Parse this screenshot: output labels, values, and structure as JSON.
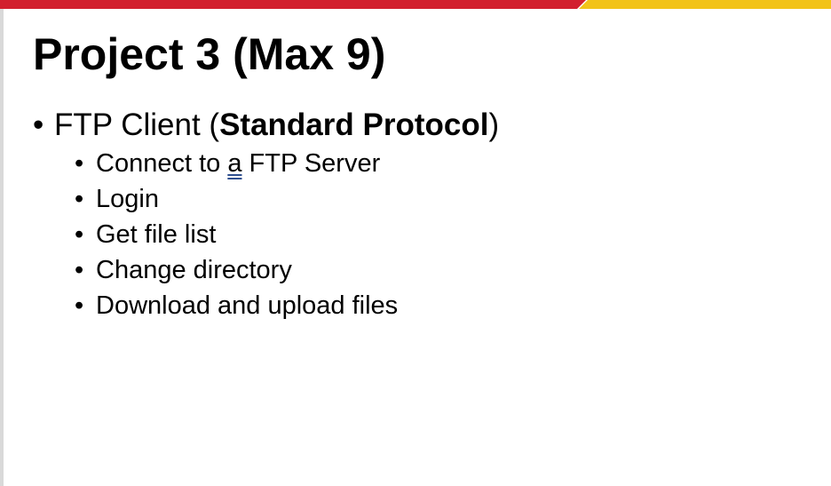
{
  "slide": {
    "title": "Project 3 (Max 9)",
    "accent_colors": {
      "red": "#d21f2e",
      "yellow": "#f2c318",
      "divider": "#ffffff"
    },
    "bullet_char": "•",
    "main_item": {
      "prefix": "FTP Client (",
      "emphasis": "Standard Protocol",
      "suffix": ")"
    },
    "sub_items": [
      {
        "before": "Connect to ",
        "marked": "a",
        "after": " FTP Server"
      },
      {
        "text": "Login"
      },
      {
        "text": "Get file list"
      },
      {
        "text": "Change directory"
      },
      {
        "text": "Download and upload files"
      }
    ]
  }
}
